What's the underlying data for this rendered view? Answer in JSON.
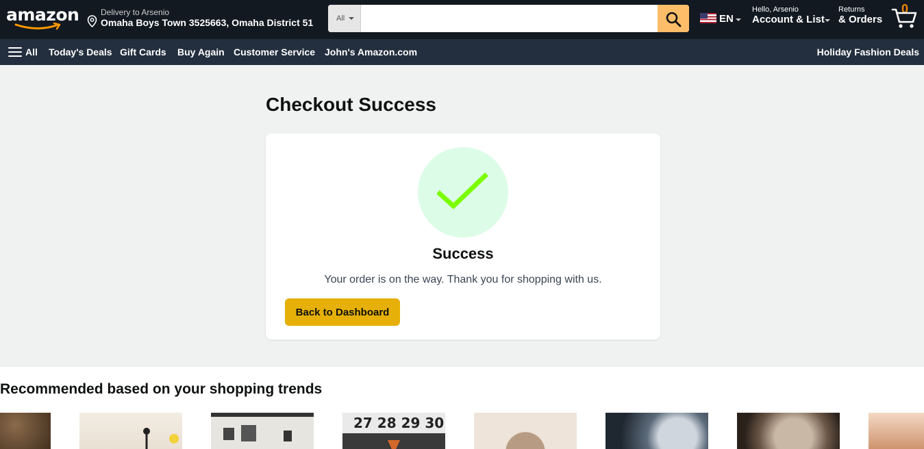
{
  "header": {
    "logo": "amazon",
    "deliver": {
      "line1": "Delivery to Arsenio",
      "line2": "Omaha Boys Town 3525663, Omaha District 51"
    },
    "search": {
      "category": "All",
      "placeholder": "",
      "value": ""
    },
    "language": "EN",
    "account": {
      "greeting": "Hello, Arsenio",
      "label": "Account & List"
    },
    "returns": {
      "line1": "Returns",
      "line2": "& Orders"
    },
    "cart_count": "0"
  },
  "subnav": {
    "all": "All",
    "items": [
      "Today's Deals",
      "Gift Cards",
      "Buy Again",
      "Customer Service",
      "John's Amazon.com"
    ],
    "promo": "Holiday Fashion Deals"
  },
  "main": {
    "title": "Checkout Success",
    "card": {
      "status": "Success",
      "message": "Your order is on the way. Thank you for shopping with us.",
      "button": "Back to Dashboard"
    }
  },
  "recommended": {
    "title": "Recommended based on your shopping trends"
  },
  "colors": {
    "header_bg": "#131921",
    "subnav_bg": "#232f3e",
    "search_button": "#febd69",
    "check_green": "#7cfc00",
    "check_circle": "#dcfce7",
    "primary_button": "#e6b008"
  }
}
